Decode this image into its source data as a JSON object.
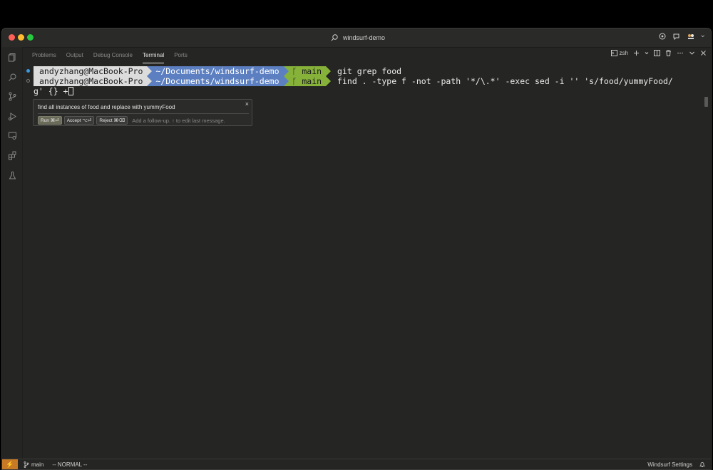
{
  "window": {
    "title": "windsurf-demo"
  },
  "panel": {
    "tabs": [
      {
        "label": "Problems"
      },
      {
        "label": "Output"
      },
      {
        "label": "Debug Console"
      },
      {
        "label": "Terminal",
        "active": true
      },
      {
        "label": "Ports"
      }
    ],
    "shell_label": "zsh"
  },
  "terminal": {
    "lines": [
      {
        "user": "andyzhang@MacBook-Pro",
        "path": "~/Documents/windsurf-demo",
        "branch_icon": "ᚴ",
        "branch": "main",
        "command": "git grep food"
      },
      {
        "user": "andyzhang@MacBook-Pro",
        "path": "~/Documents/windsurf-demo",
        "branch_icon": "ᚴ",
        "branch": "main",
        "command": "find . -type f -not -path '*/\\.*' -exec sed -i '' 's/food/yummyFood/",
        "continuation": "g' {} +"
      }
    ]
  },
  "chat": {
    "prompt": "find all instances of food and replace with yummyFood",
    "close_glyph": "×",
    "run_label": "Run ⌘⏎",
    "accept_label": "Accept ⌥⏎",
    "reject_label": "Reject ⌘⌫",
    "placeholder": "Add a follow-up. ↑ to edit last message."
  },
  "statusbar": {
    "remote_glyph": "⚡",
    "branch": "main",
    "mode": "-- NORMAL --",
    "settings_label": "Windsurf Settings"
  },
  "colors": {
    "user_segment": "#dcdcdc",
    "path_segment": "#5b7fc0",
    "git_segment": "#86b23a",
    "remote_indicator": "#c77a26"
  }
}
